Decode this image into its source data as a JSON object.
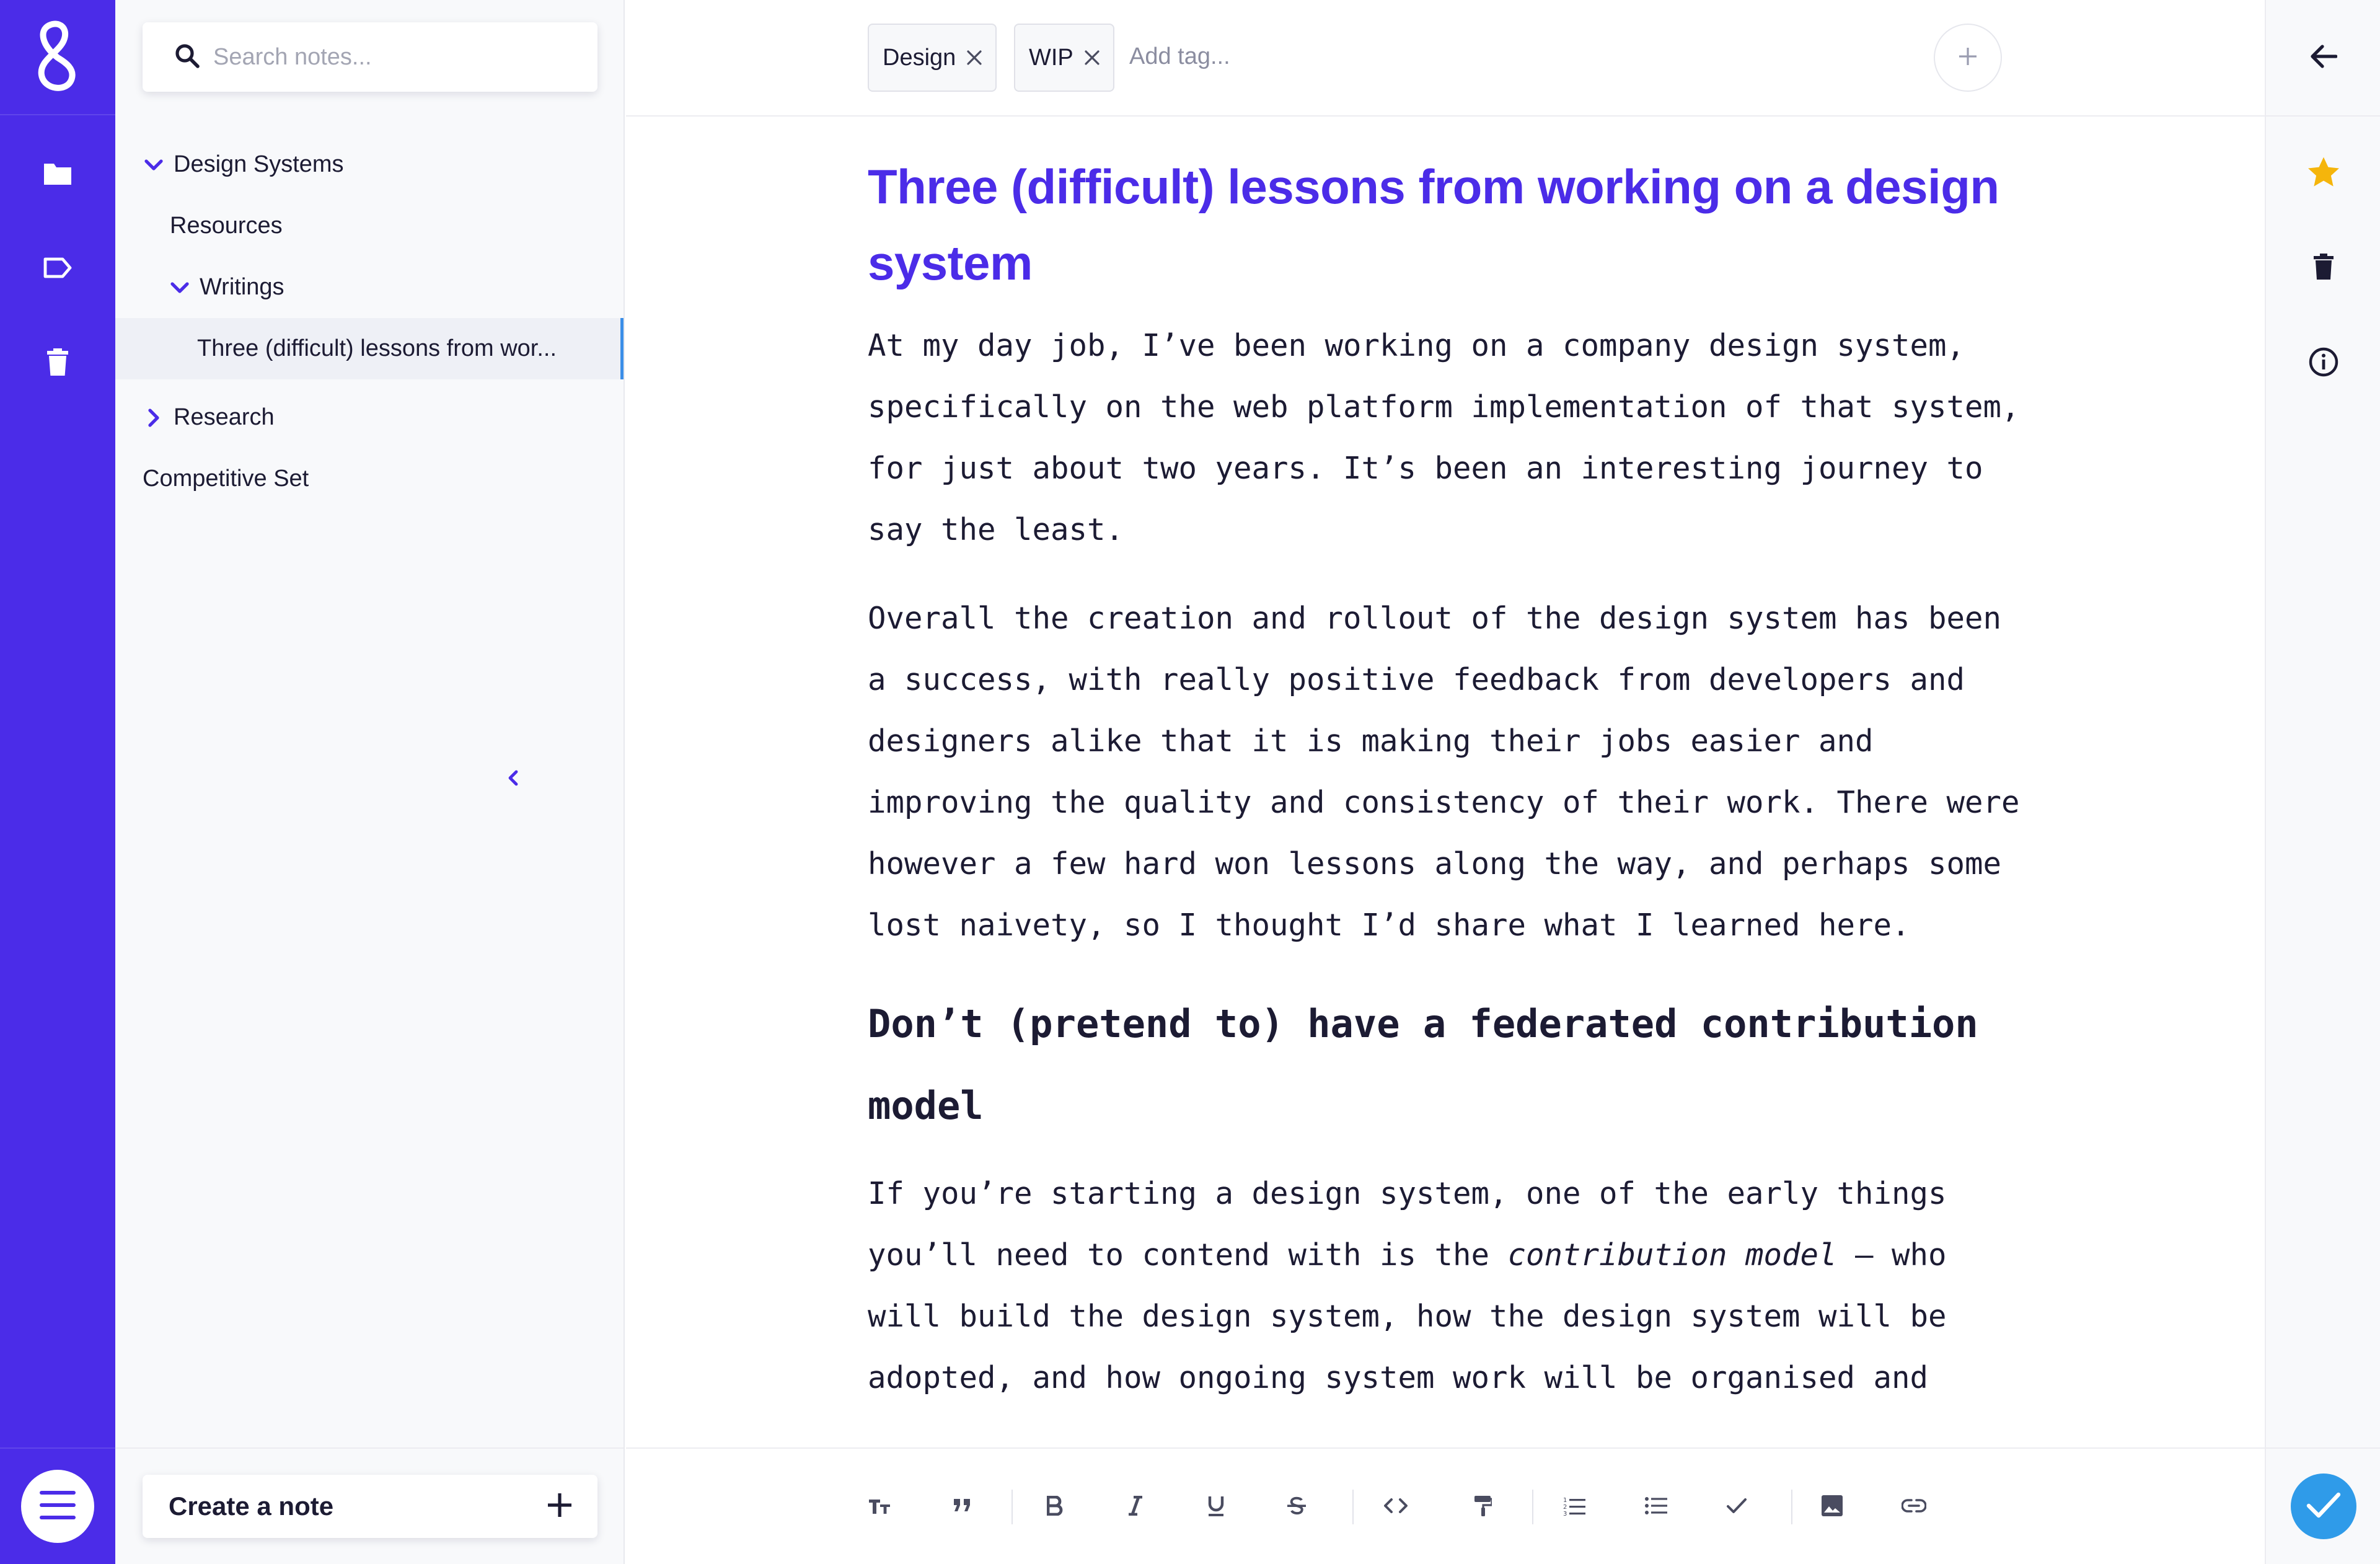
{
  "colors": {
    "brand": "#4b2ce8",
    "title": "#4b2ce8",
    "accent_blue": "#2f9be9",
    "star": "#f5b50b",
    "text": "#1c1b33"
  },
  "rail": {
    "logo_icon": "app-logo-icon",
    "items": [
      {
        "icon": "folder-icon"
      },
      {
        "icon": "tag-icon"
      },
      {
        "icon": "trash-icon"
      }
    ],
    "menu_icon": "hamburger-menu-icon"
  },
  "sidebar": {
    "search": {
      "placeholder": "Search notes..."
    },
    "tree": [
      {
        "label": "Design Systems",
        "expanded": true
      },
      {
        "label": "Resources"
      },
      {
        "label": "Writings",
        "expanded": true
      },
      {
        "label": "Three (difficult) lessons from wor...",
        "selected": true
      },
      {
        "label": "Research",
        "expanded": false
      },
      {
        "label": "Competitive Set"
      }
    ],
    "create_note_label": "Create a note"
  },
  "editor": {
    "tags": [
      {
        "label": "Design"
      },
      {
        "label": "WIP"
      }
    ],
    "add_tag_placeholder": "Add tag...",
    "title": "Three (difficult) lessons from working on a design system",
    "paragraphs": [
      "At my day job, I’ve been working on a company design system, specifically on the web platform implementation of that system, for just about two years. It’s been an interesting journey to say the least.",
      "Overall the creation and rollout of the design system has been a success, with really positive feedback from developers and designers alike that it is making their jobs easier and improving the quality and consistency of their work. There were however a few hard won lessons along the way, and perhaps some lost naivety, so I thought I’d share what I learned here."
    ],
    "heading2": "Don’t (pretend to) have a federated contribution model",
    "para3": {
      "before": "If you’re starting a design system, one of the early things you’ll need to contend with is the ",
      "emphasis": "contribution model",
      "after": " – who will build the design system, how the design system will be adopted, and how ongoing system work will be organised and"
    },
    "format_tools": [
      "text-size-icon",
      "quote-icon",
      "bold-icon",
      "italic-icon",
      "underline-icon",
      "strikethrough-icon",
      "code-icon",
      "format-paint-icon",
      "ordered-list-icon",
      "bullet-list-icon",
      "checklist-icon",
      "image-icon",
      "link-icon"
    ]
  },
  "right_rail": {
    "icons": [
      "back-arrow-icon",
      "star-icon",
      "trash-icon",
      "info-icon",
      "save-check-icon"
    ]
  }
}
